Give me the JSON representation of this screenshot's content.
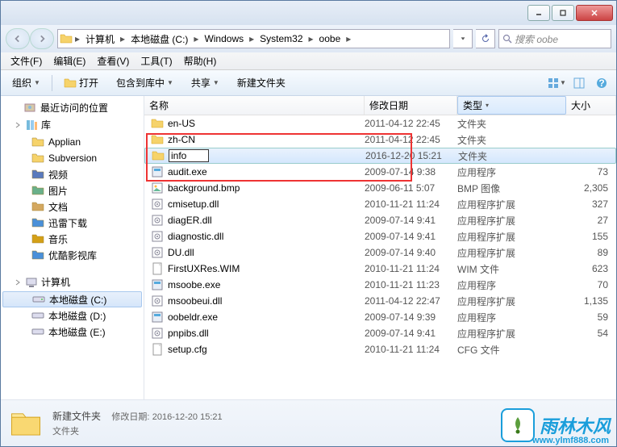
{
  "titlebar": {
    "minimize": "—",
    "maximize": "☐",
    "close": "✕"
  },
  "address": {
    "crumbs": [
      "计算机",
      "本地磁盘 (C:)",
      "Windows",
      "System32",
      "oobe"
    ],
    "search_placeholder": "搜索 oobe"
  },
  "menubar": {
    "file": "文件(F)",
    "edit": "编辑(E)",
    "view": "查看(V)",
    "tools": "工具(T)",
    "help": "帮助(H)"
  },
  "toolbar": {
    "organize": "组织",
    "open": "打开",
    "include": "包含到库中",
    "share": "共享",
    "newfolder": "新建文件夹"
  },
  "sidebar": {
    "recent": "最近访问的位置",
    "libraries": "库",
    "lib_items": [
      "Applian",
      "Subversion",
      "视频",
      "图片",
      "文档",
      "迅雷下载",
      "音乐",
      "优酷影视库"
    ],
    "computer": "计算机",
    "drives": [
      "本地磁盘 (C:)",
      "本地磁盘 (D:)",
      "本地磁盘 (E:)"
    ]
  },
  "columns": {
    "name": "名称",
    "date": "修改日期",
    "type": "类型",
    "size": "大小"
  },
  "files": [
    {
      "icon": "folder",
      "name": "en-US",
      "date": "2011-04-12 22:45",
      "type": "文件夹",
      "size": ""
    },
    {
      "icon": "folder",
      "name": "zh-CN",
      "date": "2011-04-12 22:45",
      "type": "文件夹",
      "size": ""
    },
    {
      "icon": "folder",
      "name": "info",
      "date": "2016-12-20 15:21",
      "type": "文件夹",
      "size": "",
      "editing": true
    },
    {
      "icon": "exe",
      "name": "audit.exe",
      "date": "2009-07-14 9:38",
      "type": "应用程序",
      "size": "73"
    },
    {
      "icon": "bmp",
      "name": "background.bmp",
      "date": "2009-06-11 5:07",
      "type": "BMP 图像",
      "size": "2,305"
    },
    {
      "icon": "dll",
      "name": "cmisetup.dll",
      "date": "2010-11-21 11:24",
      "type": "应用程序扩展",
      "size": "327"
    },
    {
      "icon": "dll",
      "name": "diagER.dll",
      "date": "2009-07-14 9:41",
      "type": "应用程序扩展",
      "size": "27"
    },
    {
      "icon": "dll",
      "name": "diagnostic.dll",
      "date": "2009-07-14 9:41",
      "type": "应用程序扩展",
      "size": "155"
    },
    {
      "icon": "dll",
      "name": "DU.dll",
      "date": "2009-07-14 9:40",
      "type": "应用程序扩展",
      "size": "89"
    },
    {
      "icon": "file",
      "name": "FirstUXRes.WIM",
      "date": "2010-11-21 11:24",
      "type": "WIM 文件",
      "size": "623"
    },
    {
      "icon": "exe",
      "name": "msoobe.exe",
      "date": "2010-11-21 11:23",
      "type": "应用程序",
      "size": "70"
    },
    {
      "icon": "dll",
      "name": "msoobeui.dll",
      "date": "2011-04-12 22:47",
      "type": "应用程序扩展",
      "size": "1,135"
    },
    {
      "icon": "exe",
      "name": "oobeldr.exe",
      "date": "2009-07-14 9:39",
      "type": "应用程序",
      "size": "59"
    },
    {
      "icon": "dll",
      "name": "pnpibs.dll",
      "date": "2009-07-14 9:41",
      "type": "应用程序扩展",
      "size": "54"
    },
    {
      "icon": "file",
      "name": "setup.cfg",
      "date": "2010-11-21 11:24",
      "type": "CFG 文件",
      "size": ""
    }
  ],
  "details": {
    "title": "新建文件夹",
    "meta_label": "修改日期:",
    "meta_value": "2016-12-20 15:21",
    "type": "文件夹"
  },
  "watermark": {
    "brand": "雨林木风",
    "url": "www.ylmf888.com"
  }
}
